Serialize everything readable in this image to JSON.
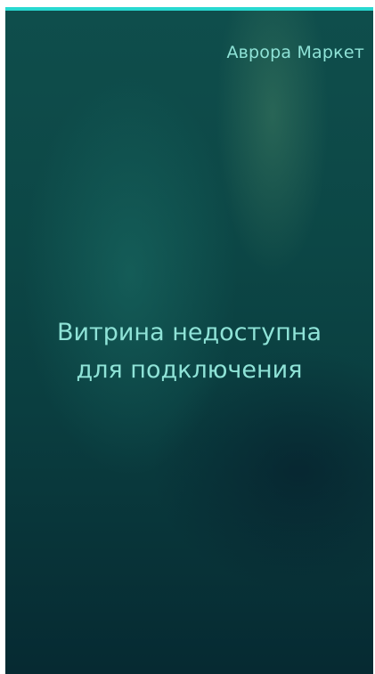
{
  "header": {
    "app_title": "Аврора Маркет"
  },
  "main": {
    "message_line1": "Витрина недоступна",
    "message_line2": "для подключения"
  },
  "colors": {
    "accent": "#28d8d0",
    "text": "#8fe3d7",
    "background": "#0c4746"
  }
}
